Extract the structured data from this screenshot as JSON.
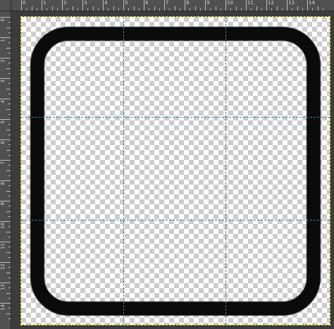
{
  "rulers": {
    "top_labels": [
      "0",
      "1",
      "2",
      "3",
      "4",
      "5",
      "6",
      "7",
      "8",
      "9",
      "10",
      "11",
      "12",
      "13",
      "14"
    ],
    "left_labels": [
      "0",
      "1",
      "2",
      "3",
      "4",
      "5",
      "6",
      "7",
      "8",
      "9",
      "10",
      "11",
      "12",
      "13",
      "14"
    ]
  },
  "canvas": {
    "background": "transparent-checkerboard",
    "shape": {
      "type": "rounded-rectangle-outline",
      "stroke_color": "#0b0b0b",
      "fill": "none"
    },
    "guides": {
      "color": "#3a7ea8",
      "vertical_count": 2,
      "horizontal_count": 2
    },
    "boundary_color": "#e8e800"
  },
  "icons": {
    "corner": "ruler-origin-icon"
  }
}
